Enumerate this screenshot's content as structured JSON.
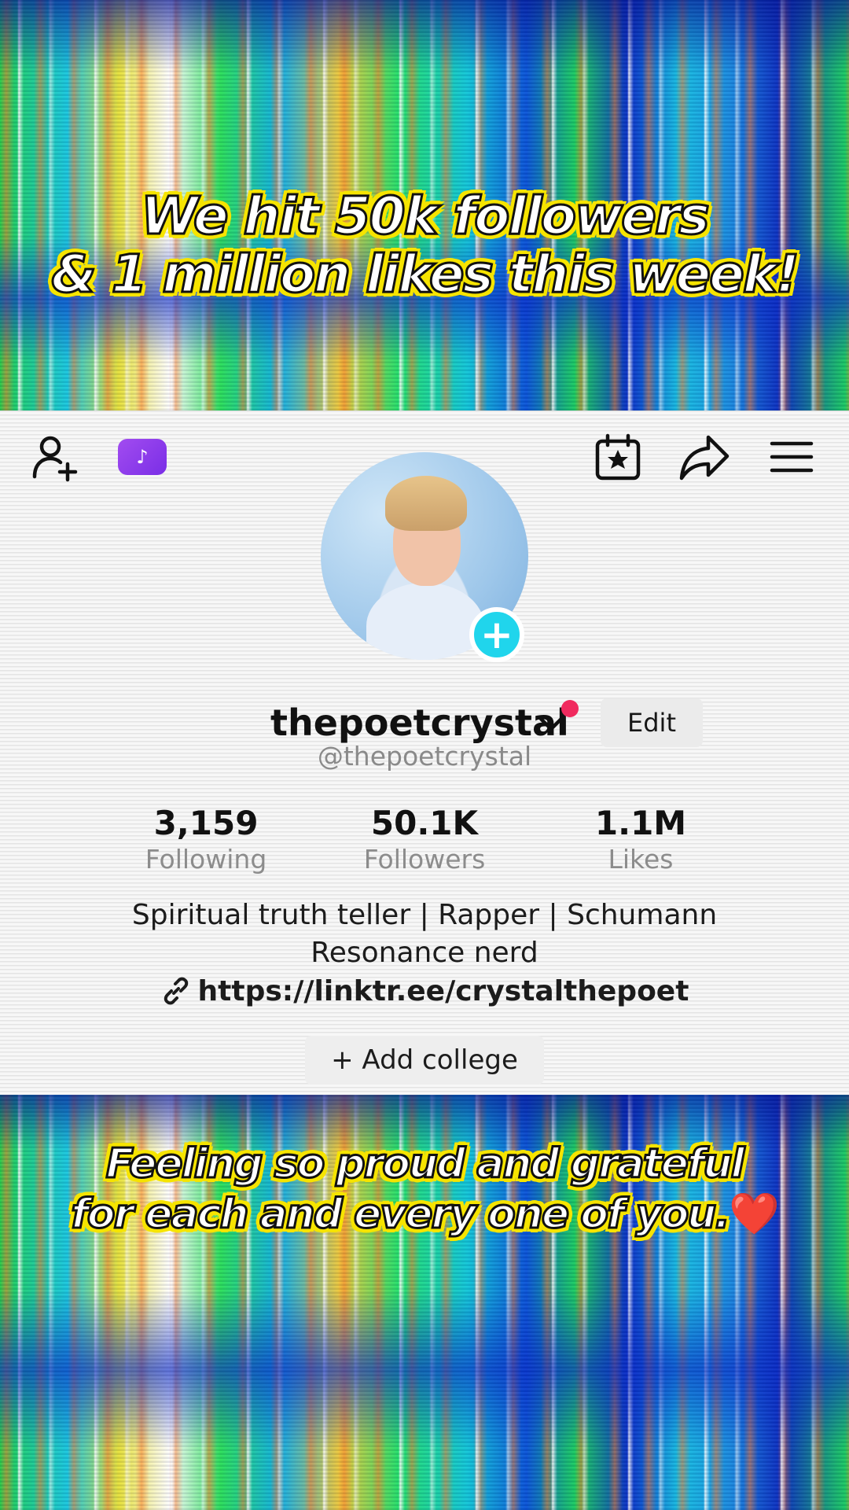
{
  "captions": {
    "top_line1": "We hit 50k followers",
    "top_line2": "& 1 million likes this week!",
    "bottom_line1": "Feeling so proud and grateful",
    "bottom_line2": "for each and every one of you.",
    "bottom_emoji": "❤️"
  },
  "topbar": {
    "add_friend_icon": "add-person-icon",
    "badge_glyph": "♪",
    "calendar_icon": "calendar-star-icon",
    "share_icon": "share-arrow-icon",
    "menu_icon": "hamburger-menu-icon"
  },
  "profile": {
    "display_name": "thepoetcrystal",
    "username": "@thepoetcrystal",
    "edit_label": "Edit",
    "follow_plus": "+",
    "stats": {
      "following_value": "3,159",
      "following_label": "Following",
      "followers_value": "50.1K",
      "followers_label": "Followers",
      "likes_value": "1.1M",
      "likes_label": "Likes"
    },
    "bio_line1": "Spiritual truth teller | Rapper | Schumann",
    "bio_line2": "Resonance nerd",
    "link": "https://linktr.ee/crystalthepoet",
    "add_college_label": "+ Add college"
  },
  "colors": {
    "accent_cyan": "#20d5ec",
    "notif_dot": "#f02a5e",
    "badge_purple": "#8a3ae8",
    "caption_outline": "#f6e400"
  }
}
